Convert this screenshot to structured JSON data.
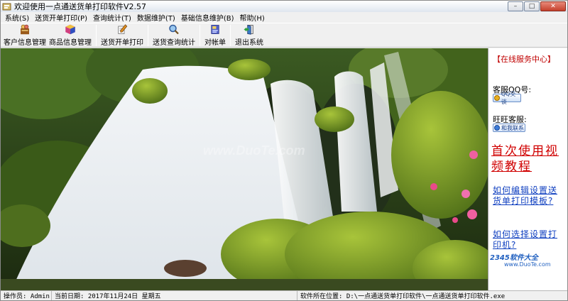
{
  "window": {
    "title": "欢迎使用一点通送货单打印软件V2.57",
    "controls": {
      "minimize": "–",
      "maximize": "□",
      "close": "✕"
    }
  },
  "menu": {
    "items": [
      {
        "label": "系统(S)"
      },
      {
        "label": "送货开单打印(P)"
      },
      {
        "label": "查询统计(T)"
      },
      {
        "label": "数据维护(T)"
      },
      {
        "label": "基础信息维护(B)"
      },
      {
        "label": "帮助(H)"
      }
    ]
  },
  "toolbar": {
    "customer": "客户信息管理",
    "product": "商品信息管理",
    "print": "送货开单打印",
    "query": "送货查询统计",
    "reconcile": "对帐单",
    "exit": "退出系统"
  },
  "sidebar": {
    "title": "【在线服务中心】",
    "qq_label": "客服QQ号:",
    "qq_badge": "QQ交谈",
    "ww_label": "旺旺客服:",
    "ww_badge": "和我联系",
    "video_link": "首次使用视频教程",
    "help1": "如何编辑设置送货单打印模板?",
    "help2": "如何选择设置打印机?"
  },
  "watermarks": {
    "center": "www.DuoTe.com",
    "corner1": "2345软件大全",
    "corner2": "www.DuoTe.com"
  },
  "status": {
    "operator": "操作员: Admin",
    "date": "当前日期: 2017年11月24日 星期五",
    "path": "软件所在位置: D:\\一点通送货单打印软件\\一点通送货单打印软件.exe"
  }
}
